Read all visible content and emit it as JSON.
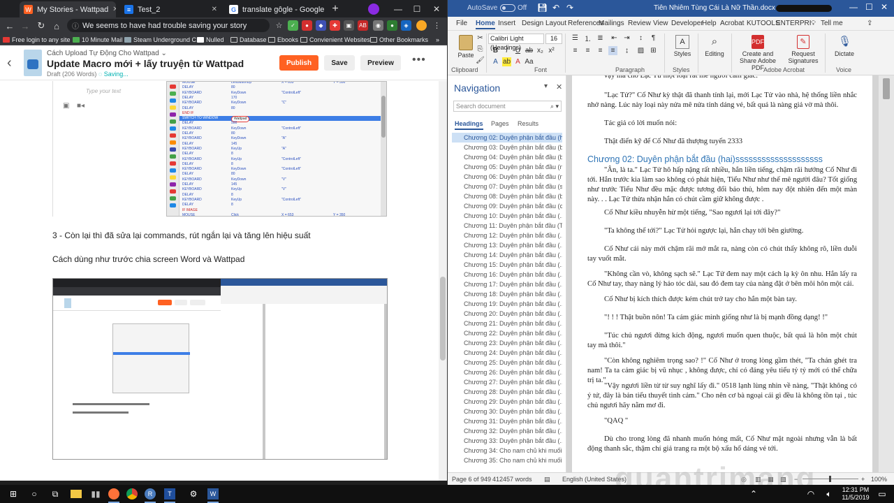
{
  "browser": {
    "tabs": [
      {
        "label": "My Stories - Wattpad",
        "icon": "wattpad-icon",
        "color": "#ff6122",
        "active": true
      },
      {
        "label": "Test_2",
        "icon": "docs-icon",
        "color": "#1a73e8",
        "active": false
      },
      {
        "label": "translate gôgle - Google Search",
        "icon": "google-icon",
        "color": "#ffffff",
        "active": false
      }
    ],
    "new_tab": "+",
    "omnibox_text": "We seems to have had trouble saving your story",
    "bookmarks": [
      "Free login to any site",
      "10 Minute Mail",
      "Steam Underground C...",
      "Nulled",
      "Database",
      "Ebooks",
      "Convienient Websites",
      "Other Bookmarks"
    ],
    "bookmarks_more": "»"
  },
  "wattpad": {
    "story_link": "Cách Upload Tự Động Cho Wattpad",
    "part_title": "Update Macro mới + lấy truyện từ Wattpad",
    "draft": "Draft (206 Words)",
    "saving": "Saving...",
    "publish": "Publish",
    "save": "Save",
    "preview": "Preview",
    "more": "•••",
    "type_text": "Type your text",
    "para1": "3 - Còn lại thì đã sửa lại commands, rút ngắn lại và tăng lên hiệu suất",
    "para2": "Cách dùng như trước chia screen Word và Wattpad",
    "macro_rows": [
      {
        "c1": "MOUSE",
        "c2": "LeftButtonUp",
        "c3": "X = 653",
        "c4": "Y = 350"
      },
      {
        "c1": "DELAY",
        "c2": "80",
        "c3": "",
        "c4": ""
      },
      {
        "c1": "KEYBOARD",
        "c2": "KeyDown",
        "c3": "\"ControlLeft\"",
        "c4": ""
      },
      {
        "c1": "DELAY",
        "c2": "170",
        "c3": "",
        "c4": ""
      },
      {
        "c1": "KEYBOARD",
        "c2": "KeyDown",
        "c3": "\"C\"",
        "c4": ""
      },
      {
        "c1": "DELAY",
        "c2": "80",
        "c3": "",
        "c4": ""
      },
      {
        "c1": "END IF",
        "c2": "",
        "c3": "",
        "c4": ""
      },
      {
        "c1": "SWITCH TO WINDOW",
        "c2": "Wattpad",
        "c3": "",
        "c4": ""
      },
      {
        "c1": "DELAY",
        "c2": "500",
        "c3": "",
        "c4": ""
      },
      {
        "c1": "KEYBOARD",
        "c2": "KeyDown",
        "c3": "\"ControlLeft\"",
        "c4": ""
      },
      {
        "c1": "DELAY",
        "c2": "80",
        "c3": "",
        "c4": ""
      },
      {
        "c1": "KEYBOARD",
        "c2": "KeyDown",
        "c3": "\"A\"",
        "c4": ""
      },
      {
        "c1": "DELAY",
        "c2": "145",
        "c3": "",
        "c4": ""
      },
      {
        "c1": "KEYBOARD",
        "c2": "KeyUp",
        "c3": "\"A\"",
        "c4": ""
      },
      {
        "c1": "DELAY",
        "c2": "8",
        "c3": "",
        "c4": ""
      },
      {
        "c1": "KEYBOARD",
        "c2": "KeyUp",
        "c3": "\"ControlLeft\"",
        "c4": ""
      },
      {
        "c1": "DELAY",
        "c2": "8",
        "c3": "",
        "c4": ""
      },
      {
        "c1": "KEYBOARD",
        "c2": "KeyDown",
        "c3": "\"ControlLeft\"",
        "c4": ""
      },
      {
        "c1": "DELAY",
        "c2": "80",
        "c3": "",
        "c4": ""
      },
      {
        "c1": "KEYBOARD",
        "c2": "KeyDown",
        "c3": "\"V\"",
        "c4": ""
      },
      {
        "c1": "DELAY",
        "c2": "145",
        "c3": "",
        "c4": ""
      },
      {
        "c1": "KEYBOARD",
        "c2": "KeyUp",
        "c3": "\"V\"",
        "c4": ""
      },
      {
        "c1": "DELAY",
        "c2": "8",
        "c3": "",
        "c4": ""
      },
      {
        "c1": "KEYBOARD",
        "c2": "KeyUp",
        "c3": "\"ControlLeft\"",
        "c4": ""
      },
      {
        "c1": "DELAY",
        "c2": "8",
        "c3": "",
        "c4": ""
      },
      {
        "c1": "IF IMAGE",
        "c2": "",
        "c3": "",
        "c4": ""
      },
      {
        "c1": "MOUSE",
        "c2": "Click",
        "c3": "X = 653",
        "c4": "Y = 350"
      }
    ]
  },
  "word": {
    "autosave": "AutoSave",
    "autosave_state": "Off",
    "filename": "Tiên Nhiêm Tùng Cái Là Nữ Thần.docx",
    "menu": [
      "File",
      "Home",
      "Insert",
      "Design",
      "Layout",
      "References",
      "Mailings",
      "Review",
      "View",
      "Developer",
      "Help",
      "Acrobat",
      "KUTOOLS",
      "ENTERPRI",
      "Tell me"
    ],
    "ribbon": {
      "paste": "Paste",
      "font_name": "Calibri Light (Headings)",
      "font_size": "16",
      "styles": "Styles",
      "editing": "Editing",
      "create_share": "Create and Share Adobe PDF",
      "request_sig": "Request Signatures",
      "dictate": "Dictate",
      "groups": [
        "Clipboard",
        "Font",
        "Paragraph",
        "Styles",
        "Adobe Acrobat",
        "Voice"
      ]
    },
    "nav": {
      "title": "Navigation",
      "search_placeholder": "Search document",
      "tabs": [
        "Headings",
        "Pages",
        "Results"
      ],
      "items": [
        "Chương 02: Duyên phận bắt đầu (h...",
        "Chương 03: Duyên phận bắt đầu (ba)",
        "Chương 04: Duyên phận bắt đầu (b...",
        "Chương 05: Duyên phận bắt đầu (n...",
        "Chương 06: Duyên phận bắt đầu (n...",
        "Chương 07: Duyên phận bắt đầu (s...",
        "Chương 08: Duyên phận bắt đầu (b...",
        "Chương 09: Duyên phận bắt đầu (c...",
        "Chương 10: Duyên phận bắt đầu (...",
        "Chương 11: Duyên phận bắt đầu (T...",
        "Chương 12: Duyên phận bắt đầu (...",
        "Chương 13: Duyên phận bắt đầu (...",
        "Chương 14: Duyên phận bắt đầu (...",
        "Chương 15: Duyên phận bắt đầu (...",
        "Chương 16: Duyên phận bắt đầu (...",
        "Chương 17: Duyên phận bắt đầu (...",
        "Chương 18: Duyên phận bắt đầu (...",
        "Chương 19: Duyên phận bắt đầu (...",
        "Chương 20: Duyên phận bắt đầu (...",
        "Chương 21: Duyên phận bắt đầu (...",
        "Chương 22: Duyên phận bắt đầu (...",
        "Chương 23: Duyên phận bắt đầu (...",
        "Chương 24: Duyên phận bắt đầu (...",
        "Chương 25: Duyên phận bắt đầu (...",
        "Chương 26: Duyên phận bắt đầu (...",
        "Chương 27: Duyên phận bắt đầu (...",
        "Chương 28: Duyên phận bắt đầu (...",
        "Chương 29: Duyên phận bắt đầu (...",
        "Chương 30: Duyên phận bắt đầu (...",
        "Chương 31: Duyên phận bắt đầu (...",
        "Chương 32: Duyên phận bắt đầu (...",
        "Chương 33: Duyên phận bắt đầu (...",
        "Chương 34: Cho nam chủ khi muối...",
        "Chương 35: Cho nam chủ khi muối..."
      ]
    },
    "doc": {
      "p0": "vậy mà cho Lạc Tử một loại rất mê người cảm giác.",
      "p1": "\"Lạc Tử?\" Cố Như kỳ thật đã thanh tỉnh lại, mới Lạc Tử vào nhà, hệ thống liền nhắc nhở nàng. Lúc này loại này nửa mê nửa tỉnh dáng vẻ, bất quá là nàng giả vờ mà thôi.",
      "p2": "Tác giả có lời muốn nói:",
      "p3": "Thật điển kỹ để Cố Như đã thượng tuyến 2333",
      "heading": "Chương 02: Duyên phận bắt đầu (hai)ssssssssssssssssssss",
      "p4": "\"Ân, là ta.\" Lạc Tử hô hấp nặng rất nhiều, hắn liền tiếng, chậm rãi hướng Cố Như đi tới. Hắn trước kia làm sao không có phát hiện, Tiểu Như như thế mê người đâu? Tốt giống như trước Tiểu Như đều mặc được tương đối bảo thủ, hôm nay đột nhiên đến một màn này. . . Lạc Tử thừa nhận hắn có chút cầm giữ không được .",
      "p5": "Cố Như kiều nhuyễn hừ một tiếng, \"Sao ngươi lại tới đây?\"",
      "p6": "\"Ta không thể tới?\" Lạc Tử hỏi ngược lại, hắn chạy tới bên giường.",
      "p7": "Cố Như cái này mới chậm rãi mở mắt ra, nàng còn có chút thấy không rõ, liền duỗi tay vuốt mắt.",
      "p8": "\"Không cần vò, không sạch sẽ.\" Lạc Tử đem nay một cách lạ kỳ ôn nhu. Hắn lấy ra Cố Như tay, thay nàng lý hảo tóc dài, sau đó đem tay của nàng đặt ở bên môi hôn một cái.",
      "p9": "Cố Như bị kích thích được kém chút trở tay cho hắn một bàn tay.",
      "p10": "\"! ! ! Thật buồn nôn! Ta cảm giác mình giống như là bị mạnh đồng dạng! !\"",
      "p11": "\"Túc chủ ngươi đừng kích động, ngươi muốn quen thuộc, bất quá là hôn một chút tay mà thôi.\"",
      "p12": "\"Còn không nghiêm trọng sao? !\" Cố Như ở trong lòng gầm thét, \"Ta chán ghét tra nam! Ta ta cảm giác bị vũ nhục , không được, chỉ có đáng yêu tiểu tỷ tỷ mới có thể chữa trị ta.\"",
      "p13": "\"Vậy ngươi liền từ từ suy nghĩ lấy đi.\" 0518 lạnh lùng nhìn về nàng, \"Thật không có ý tứ, đây là bản tiểu thuyết tình cảm.\" Cho nên cơ bà ngoại cái gì đều là không tồn tại , túc chủ ngươi hãy nằm mơ đi.",
      "p14": "\"QAQ \"",
      "p15": "Dù cho trong lòng đã nhanh muốn hỏng mất, Cố Như mặt ngoài nhưng vẫn là bất động thanh sắc, thậm chí giả trang ra một bộ xấu hổ dáng vẻ tới."
    },
    "status": {
      "page": "Page 6 of 949",
      "words": "412457 words",
      "language": "English (United States)",
      "zoom": "100%"
    }
  },
  "taskbar": {
    "time": "12:31 PM",
    "date": "11/5/2019"
  },
  "watermark": "quantrimang"
}
